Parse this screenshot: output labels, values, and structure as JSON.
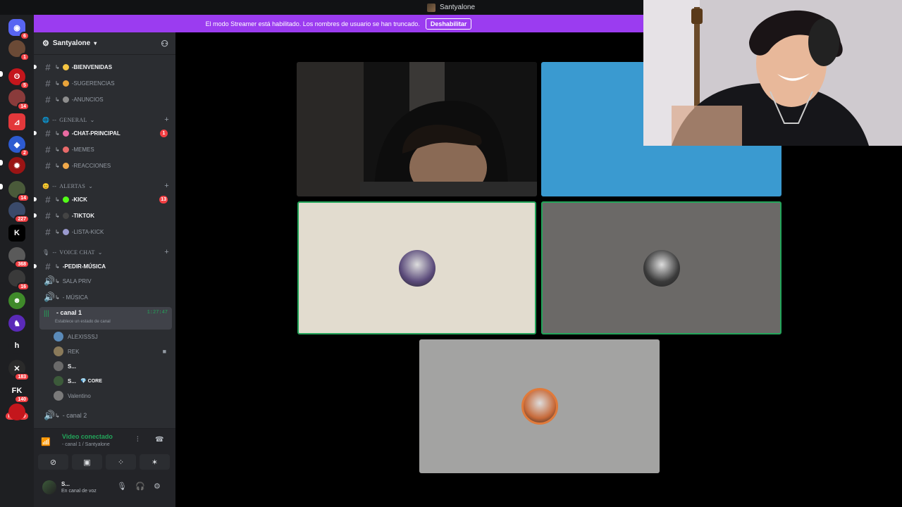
{
  "window": {
    "title": "Santyalone"
  },
  "banner": {
    "message": "El modo Streamer está habilitado. Los nombres de usuario se han truncado.",
    "button": "Deshabilitar"
  },
  "rail": {
    "new_label": "NUEVO",
    "servers": [
      {
        "name": "discord-home",
        "badge": "6",
        "color": "#5865f2",
        "glyph": "◉"
      },
      {
        "name": "server-avatar-1",
        "badge": "1",
        "color": "#6b4a36",
        "glyph": ""
      },
      {
        "name": "server-red-1",
        "badge": "5",
        "color": "#c4161c",
        "glyph": "ʘ"
      },
      {
        "name": "server-avatar-2",
        "badge": "14",
        "color": "#8a3b3b",
        "glyph": ""
      },
      {
        "name": "server-red-2",
        "badge": "",
        "color": "#e3383b",
        "glyph": "⊿"
      },
      {
        "name": "server-blue-1",
        "badge": "2",
        "color": "#2d5bd1",
        "glyph": "◆"
      },
      {
        "name": "server-red-3",
        "badge": "",
        "color": "#9a1414",
        "glyph": "✹"
      },
      {
        "name": "server-avatar-3",
        "badge": "14",
        "color": "#4a5a3a",
        "glyph": ""
      },
      {
        "name": "server-avatar-4",
        "badge": "227",
        "color": "#3a4a6a",
        "glyph": ""
      },
      {
        "name": "server-kick",
        "badge": "",
        "color": "#000000",
        "glyph": "K"
      },
      {
        "name": "server-avatar-5",
        "badge": "368",
        "color": "#5a5a5a",
        "glyph": ""
      },
      {
        "name": "server-avatar-6",
        "badge": "16",
        "color": "#3a3a3a",
        "glyph": ""
      },
      {
        "name": "server-green",
        "badge": "",
        "color": "#3f8a2a",
        "glyph": "☻"
      },
      {
        "name": "server-purple",
        "badge": "",
        "color": "#5a2ab8",
        "glyph": "♞"
      },
      {
        "name": "server-h",
        "badge": "",
        "color": "#1e1f22",
        "glyph": "h"
      },
      {
        "name": "server-avatar-7",
        "badge": "183",
        "color": "#2a2a2a",
        "glyph": "✕"
      },
      {
        "name": "server-fk",
        "badge": "140",
        "color": "#1e1f22",
        "glyph": "FK"
      },
      {
        "name": "server-bottom",
        "badge": "",
        "color": "#c4161c",
        "glyph": ""
      }
    ]
  },
  "sidebar": {
    "server_name": "Santyalone",
    "channels_top": [
      {
        "label": "-BIENVENIDAS",
        "emoji_color": "#f5c542",
        "bright": true
      },
      {
        "label": "-SUGERENCIAS",
        "emoji_color": "#e8a33a",
        "bright": false
      },
      {
        "label": "-ANUNCIOS",
        "emoji_color": "#8e8e8e",
        "bright": false
      }
    ],
    "cat_general": "GENERAL",
    "channels_general": [
      {
        "label": "-CHAT-PRINCIPAL",
        "emoji_color": "#e86aa1",
        "bright": true,
        "count": "1"
      },
      {
        "label": "-MEMES",
        "emoji_color": "#e86a6a",
        "bright": false
      },
      {
        "label": "-REACCIONES",
        "emoji_color": "#f0a94a",
        "bright": false
      }
    ],
    "cat_alertas": "ALERTAS",
    "channels_alertas": [
      {
        "label": "-KICK",
        "emoji_color": "#53fc18",
        "bright": true,
        "count": "13"
      },
      {
        "label": "-TIKTOK",
        "emoji_color": "#444444",
        "bright": true
      },
      {
        "label": "-LISTA-KICK",
        "emoji_color": "#9a9acf",
        "bright": false
      }
    ],
    "cat_voice": "VOICE CHAT",
    "channels_voice": [
      {
        "label": "-PEDIR-MÚSICA",
        "bright": true
      },
      {
        "label": "SALA PRIV",
        "bright": false
      },
      {
        "label": "- MÚSICA",
        "bright": false
      }
    ],
    "active_vc": {
      "name": "- canal 1",
      "timer": "1:27:47",
      "status": "Establece un estado de canal"
    },
    "vc_users": [
      {
        "name": "ALEXISSSJ",
        "bold": false,
        "color": "#5a8ab8",
        "cam": false
      },
      {
        "name": "REK",
        "bold": false,
        "color": "#8a7a5a",
        "cam": true
      },
      {
        "name": "S...",
        "bold": true,
        "color": "#6a6a6a",
        "cam": false
      },
      {
        "name": "S...",
        "bold": true,
        "color": "#3c5a3a",
        "cam": false,
        "tag": "💎 CORE"
      },
      {
        "name": "Valentino",
        "bold": false,
        "color": "#7a7a7a",
        "cam": false
      }
    ],
    "channel_2": "- canal 2"
  },
  "voice_panel": {
    "title": "Video conectado",
    "subtitle": "- canal 1 / Santyalone"
  },
  "user_panel": {
    "name": "S...",
    "status": "En canal de voz"
  },
  "video_tiles": [
    {
      "name": "camera-tile-user",
      "bg": "#151515",
      "speaking": false,
      "avatar_color": ""
    },
    {
      "name": "avatar-tile-blue",
      "bg": "#3a9ad0",
      "speaking": false,
      "avatar_color": ""
    },
    {
      "name": "avatar-tile-cream",
      "bg": "#e2dccf",
      "speaking": true,
      "avatar_color": "#5a4a7a"
    },
    {
      "name": "avatar-tile-gray",
      "bg": "#6b6967",
      "speaking": true,
      "avatar_color": "#3a3a3a"
    },
    {
      "name": "avatar-tile-silver",
      "bg": "#a3a3a2",
      "speaking": false,
      "avatar_color": "#c76a3a"
    }
  ]
}
